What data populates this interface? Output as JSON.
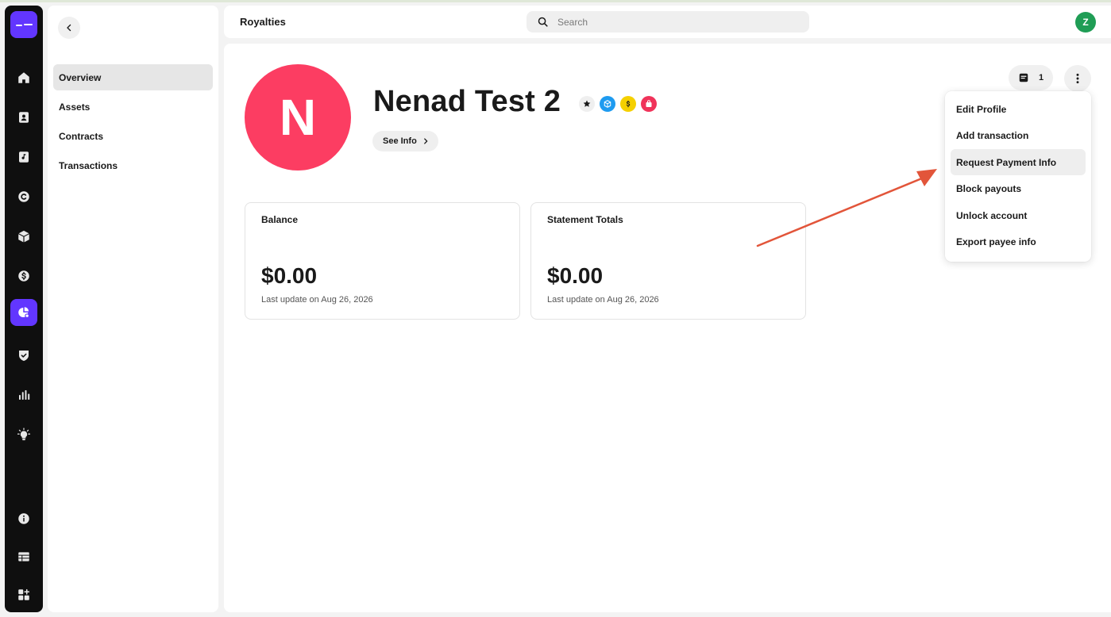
{
  "header": {
    "title": "Royalties",
    "search_placeholder": "Search",
    "user_initial": "Z"
  },
  "rail": {
    "items": [
      {
        "icon": "home-icon"
      },
      {
        "icon": "contact-card-icon"
      },
      {
        "icon": "music-note-icon"
      },
      {
        "icon": "copyright-icon"
      },
      {
        "icon": "cube-icon"
      },
      {
        "icon": "dollar-icon"
      },
      {
        "icon": "royalties-pie-icon",
        "active": true
      },
      {
        "icon": "shield-check-icon"
      },
      {
        "icon": "bar-chart-icon"
      },
      {
        "icon": "lightbulb-icon"
      },
      {
        "icon": "info-icon"
      },
      {
        "icon": "table-icon"
      },
      {
        "icon": "apps-add-icon"
      }
    ]
  },
  "sidebar": {
    "items": [
      {
        "label": "Overview",
        "active": true
      },
      {
        "label": "Assets"
      },
      {
        "label": "Contracts"
      },
      {
        "label": "Transactions"
      }
    ]
  },
  "profile": {
    "initial": "N",
    "name": "Nenad Test 2",
    "see_info_label": "See Info",
    "avatar_color": "#fc3d62",
    "badges": [
      "star-icon",
      "cube-icon",
      "dollar-icon",
      "shopping-bag-icon"
    ]
  },
  "cards": [
    {
      "label": "Balance",
      "value": "$0.00",
      "updated": "Last update on Aug 26, 2026"
    },
    {
      "label": "Statement Totals",
      "value": "$0.00",
      "updated": "Last update on Aug 26, 2026"
    }
  ],
  "notes": {
    "count": "1"
  },
  "menu": {
    "items": [
      {
        "label": "Edit Profile"
      },
      {
        "label": "Add transaction"
      },
      {
        "label": "Request Payment Info",
        "hover": true
      },
      {
        "label": "Block payouts"
      },
      {
        "label": "Unlock account"
      },
      {
        "label": "Export payee info"
      }
    ]
  },
  "colors": {
    "accent": "#6236ff",
    "user_avatar": "#1f9d55",
    "annotation_arrow": "#e2553a"
  }
}
